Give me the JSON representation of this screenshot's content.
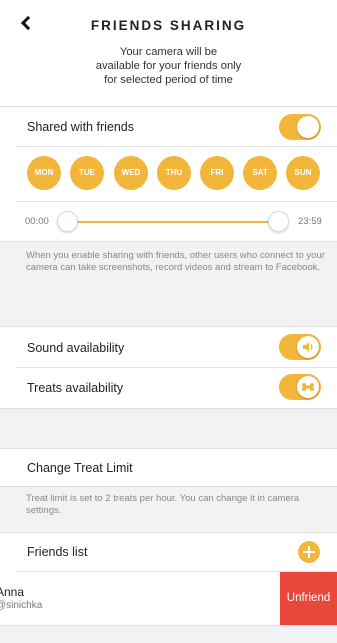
{
  "header": {
    "title": "FRIENDS SHARING",
    "subtitle_lines": [
      "Your camera will be",
      "available for your friends only",
      "for selected period of time"
    ]
  },
  "shared": {
    "label": "Shared with friends",
    "enabled": true
  },
  "days": [
    "MON",
    "TUE",
    "WED",
    "THU",
    "FRI",
    "SAT",
    "SUN"
  ],
  "time_range": {
    "start": "00:00",
    "end": "23:59"
  },
  "sharing_info": "When you enable sharing with friends, other users who connect to your camera can take screenshots, record videos and stream to Facebook.",
  "sound": {
    "label": "Sound availability",
    "enabled": true,
    "icon": "speaker-icon"
  },
  "treats": {
    "label": "Treats availability",
    "enabled": true,
    "icon": "bone-icon"
  },
  "treat_limit": {
    "label": "Change Treat Limit",
    "info": "Treat limit is set to 2 treats per hour. You can change it in camera settings."
  },
  "friends_list": {
    "label": "Friends list",
    "add_icon": "plus-icon",
    "friends": [
      {
        "name": "Anna",
        "handle": "@sinichka"
      }
    ],
    "unfriend_label": "Unfriend"
  },
  "colors": {
    "accent": "#f2b63b",
    "danger": "#e8483a",
    "background": "#f2f2f4"
  }
}
